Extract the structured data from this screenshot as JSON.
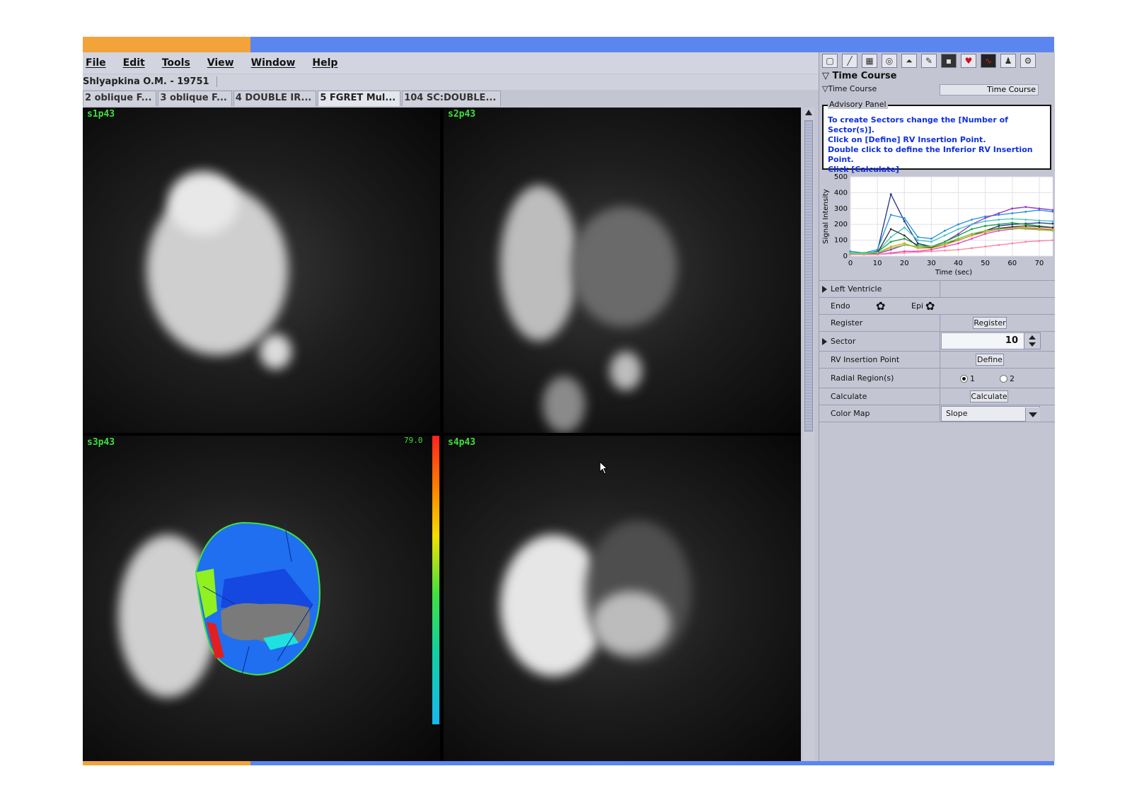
{
  "menu": [
    "File",
    "Edit",
    "Tools",
    "View",
    "Window",
    "Help"
  ],
  "patient": "Shlyapkina O.M. - 19751",
  "tabs": [
    {
      "label": "2 oblique F..."
    },
    {
      "label": "3 oblique F..."
    },
    {
      "label": "4 DOUBLE IR..."
    },
    {
      "label": "5 FGRET Mul..."
    },
    {
      "label": "104 SC:DOUBLE..."
    }
  ],
  "viewports": [
    {
      "label": "s1p43"
    },
    {
      "label": "s2p43"
    },
    {
      "label": "s3p43",
      "colorbar_max": "79.0"
    },
    {
      "label": "s4p43"
    }
  ],
  "panel": {
    "section_title": "Time Course",
    "time_course_label": "Time Course",
    "time_course_field": "Time Course",
    "advisory_title": "Advisory Panel",
    "advisory_lines": [
      "To create Sectors change the [Number of Sector(s)].",
      "Click on [Define] RV Insertion Point.",
      "Double click to define the Inferior RV Insertion Point.",
      "Click [Calculate]"
    ],
    "left_ventricle": "Left Ventricle",
    "endo": "Endo",
    "epi": "Epi",
    "register_label": "Register",
    "register_button": "Register",
    "sector_label": "Sector",
    "sector_value": "10",
    "rv_label": "RV Insertion Point",
    "define_button": "Define",
    "radial_label": "Radial Region(s)",
    "radial_options": [
      "1",
      "2"
    ],
    "radial_selected": "1",
    "calculate_label": "Calculate",
    "calculate_button": "Calculate",
    "colormap_label": "Color Map",
    "colormap_value": "Slope"
  },
  "chart_data": {
    "type": "line",
    "ylabel": "Signal Intensity",
    "xlabel": "Time (sec)",
    "xlim": [
      0,
      75
    ],
    "ylim": [
      0,
      500
    ],
    "xticks": [
      "0",
      "10",
      "20",
      "30",
      "40",
      "50",
      "60",
      "70"
    ],
    "yticks": [
      "500",
      "400",
      "300",
      "200",
      "100",
      "0"
    ],
    "x": [
      0,
      5,
      10,
      15,
      20,
      25,
      30,
      35,
      40,
      45,
      50,
      55,
      60,
      65,
      70,
      75
    ],
    "series": [
      {
        "color": "#203080",
        "values": [
          20,
          15,
          30,
          390,
          220,
          80,
          60,
          80,
          100,
          130,
          160,
          190,
          200,
          205,
          210,
          205
        ]
      },
      {
        "color": "#2090e0",
        "values": [
          30,
          20,
          40,
          260,
          240,
          120,
          110,
          160,
          200,
          230,
          250,
          260,
          270,
          280,
          290,
          280
        ]
      },
      {
        "color": "#9030d0",
        "values": [
          10,
          10,
          15,
          40,
          70,
          60,
          60,
          90,
          140,
          200,
          240,
          270,
          300,
          310,
          300,
          290
        ]
      },
      {
        "color": "#10a040",
        "values": [
          20,
          20,
          25,
          90,
          110,
          70,
          60,
          90,
          130,
          170,
          190,
          200,
          210,
          200,
          190,
          180
        ]
      },
      {
        "color": "#e040c0",
        "values": [
          10,
          10,
          10,
          20,
          30,
          30,
          40,
          60,
          80,
          110,
          140,
          160,
          170,
          175,
          170,
          165
        ]
      },
      {
        "color": "#e0a020",
        "values": [
          15,
          15,
          20,
          60,
          80,
          50,
          50,
          70,
          100,
          130,
          150,
          170,
          180,
          180,
          175,
          170
        ]
      },
      {
        "color": "#40c0c0",
        "values": [
          20,
          20,
          25,
          120,
          180,
          100,
          90,
          130,
          170,
          200,
          220,
          230,
          235,
          230,
          225,
          220
        ]
      },
      {
        "color": "#303030",
        "values": [
          15,
          12,
          20,
          170,
          130,
          60,
          55,
          80,
          110,
          140,
          160,
          175,
          185,
          190,
          185,
          180
        ]
      },
      {
        "color": "#ff80a0",
        "values": [
          10,
          10,
          10,
          15,
          20,
          25,
          30,
          35,
          40,
          50,
          60,
          70,
          80,
          90,
          95,
          100
        ]
      },
      {
        "color": "#80d040",
        "values": [
          15,
          15,
          20,
          50,
          70,
          60,
          60,
          80,
          110,
          140,
          160,
          170,
          175,
          170,
          165,
          160
        ]
      }
    ]
  }
}
